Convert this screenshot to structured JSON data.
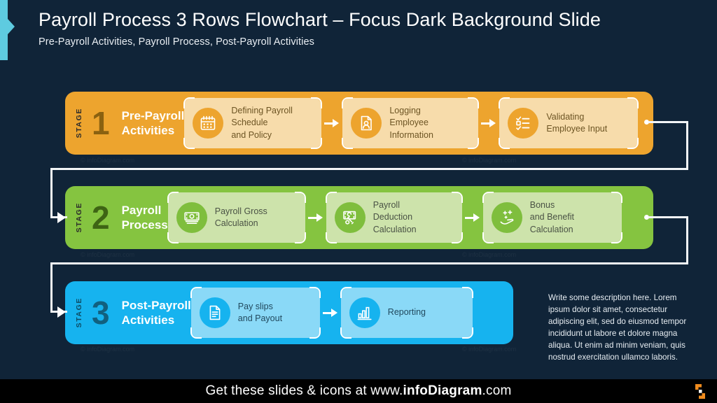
{
  "slide": {
    "background_color": "#102438",
    "title": "Payroll Process 3 Rows Flowchart – Focus Dark Background Slide",
    "subtitle": "Pre-Payroll Activities, Payroll Process, Post-Payroll Activities",
    "accent_color": "#5ecbe0"
  },
  "rows": [
    {
      "stage_word": "STAGE",
      "stage_number": "1",
      "stage_title": "Pre-Payroll\nActivities",
      "stage_title_line1": "Pre-Payroll",
      "stage_title_line2": "Activities",
      "color": "#eda42e",
      "card_color": "#f7dcab",
      "steps": [
        {
          "icon": "calendar-icon",
          "label_lines": [
            "Defining Payroll",
            "Schedule",
            "and Policy"
          ]
        },
        {
          "icon": "employee-document-icon",
          "label_lines": [
            "Logging",
            "Employee",
            "Information"
          ]
        },
        {
          "icon": "checklist-icon",
          "label_lines": [
            "Validating",
            "Employee Input"
          ]
        }
      ]
    },
    {
      "stage_word": "STAGE",
      "stage_number": "2",
      "stage_title_line1": "Payroll",
      "stage_title_line2": "Process",
      "color": "#85c440",
      "card_color": "#cde3ab",
      "steps": [
        {
          "icon": "banknote-icon",
          "label_lines": [
            "Payroll  Gross",
            "Calculation"
          ]
        },
        {
          "icon": "banknote-cut-icon",
          "label_lines": [
            "Payroll",
            "Deduction",
            "Calculation"
          ]
        },
        {
          "icon": "hand-bonus-icon",
          "label_lines": [
            "Bonus",
            "and Benefit",
            "Calculation"
          ]
        }
      ]
    },
    {
      "stage_word": "STAGE",
      "stage_number": "3",
      "stage_title_line1": "Post-Payroll",
      "stage_title_line2": "Activities",
      "color": "#16b3ef",
      "card_color": "#8ad9f7",
      "steps": [
        {
          "icon": "payslip-document-icon",
          "label_lines": [
            "Pay slips",
            "and Payout"
          ]
        },
        {
          "icon": "bar-chart-icon",
          "label_lines": [
            "Reporting"
          ]
        }
      ]
    }
  ],
  "description": "Write some description here. Lorem ipsum dolor sit amet, consectetur adipiscing elit, sed do eiusmod tempor  incididunt ut labore et dolore magna aliqua. Ut enim ad minim veniam, quis nostrud exercitation ullamco laboris.",
  "footer": {
    "text_before": "Get these slides & icons at www.",
    "text_brand": "infoDiagram",
    "text_after": ".com",
    "logo_color": "#f08c1e",
    "background": "#000000"
  }
}
